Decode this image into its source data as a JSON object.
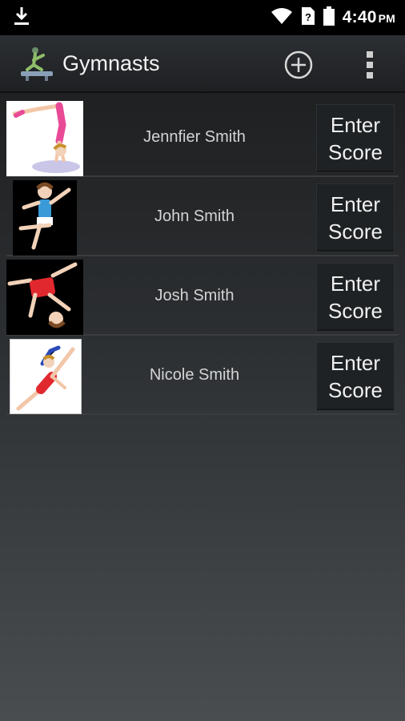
{
  "status_bar": {
    "time": "4:40",
    "ampm": "PM",
    "icons": [
      "download-icon",
      "wifi-icon",
      "sim-icon",
      "battery-icon"
    ]
  },
  "action_bar": {
    "title": "Gymnasts",
    "app_icon": "gymnast-app-icon",
    "add_icon": "add-circle-icon",
    "overflow_icon": "overflow-menu-icon"
  },
  "gymnasts": [
    {
      "name": "Jennfier Smith",
      "button_line1": "Enter",
      "button_line2": "Score",
      "photo": "handstand-girl-photo"
    },
    {
      "name": "John Smith",
      "button_line1": "Enter",
      "button_line2": "Score",
      "photo": "boy-gymnast-photo"
    },
    {
      "name": "Josh Smith",
      "button_line1": "Enter",
      "button_line2": "Score",
      "photo": "cartwheel-boy-photo"
    },
    {
      "name": "Nicole Smith",
      "button_line1": "Enter",
      "button_line2": "Score",
      "photo": "leap-girl-photo"
    }
  ],
  "colors": {
    "status_bar_bg": "#000000",
    "action_bar_bg": "#2c2f33",
    "button_bg": "#1f2224",
    "name_text": "#d4d4d4"
  }
}
